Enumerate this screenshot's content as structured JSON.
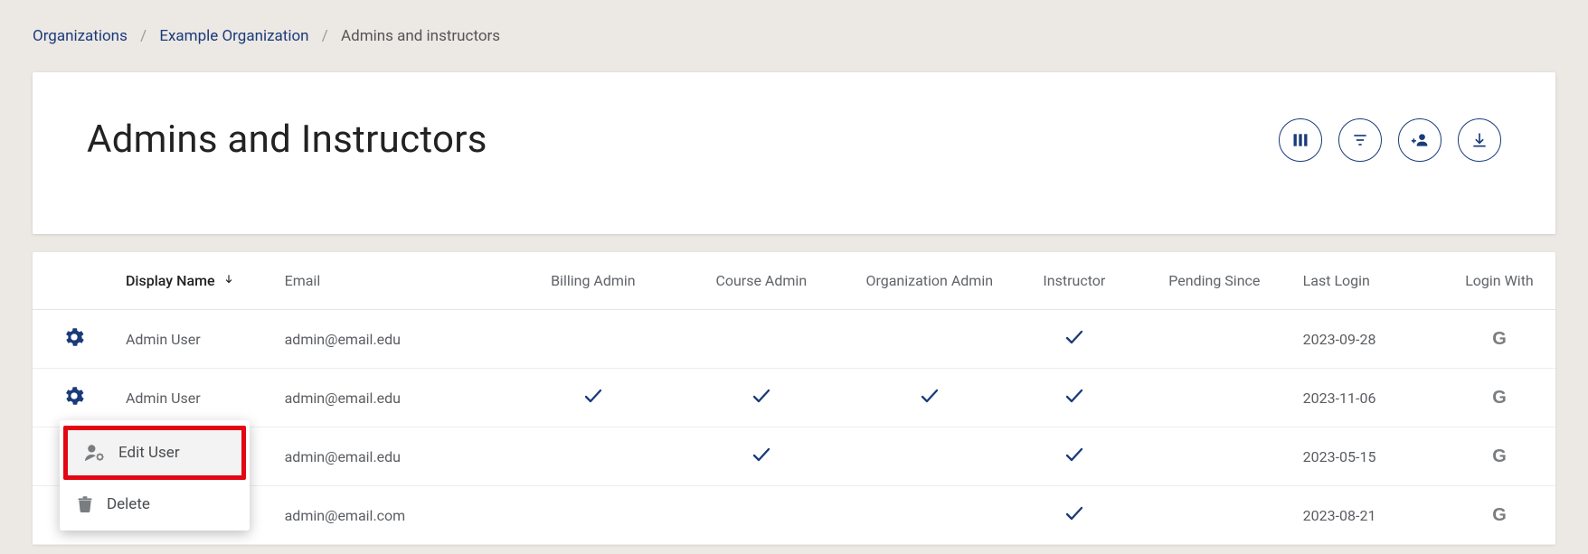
{
  "breadcrumb": {
    "organizations": "Organizations",
    "org": "Example Organization",
    "current": "Admins and instructors"
  },
  "header": {
    "title": "Admins and Instructors"
  },
  "table": {
    "columns": {
      "display_name": "Display Name",
      "email": "Email",
      "billing_admin": "Billing Admin",
      "course_admin": "Course Admin",
      "org_admin": "Organization Admin",
      "instructor": "Instructor",
      "pending_since": "Pending Since",
      "last_login": "Last Login",
      "login_with": "Login With"
    },
    "rows": [
      {
        "display_name": "Admin User",
        "email": "admin@email.edu",
        "billing_admin": false,
        "course_admin": false,
        "org_admin": false,
        "instructor": true,
        "pending_since": "",
        "last_login": "2023-09-28",
        "login_with": "G"
      },
      {
        "display_name": "Admin User",
        "email": "admin@email.edu",
        "billing_admin": true,
        "course_admin": true,
        "org_admin": true,
        "instructor": true,
        "pending_since": "",
        "last_login": "2023-11-06",
        "login_with": "G"
      },
      {
        "display_name": "",
        "email": "admin@email.edu",
        "billing_admin": false,
        "course_admin": true,
        "org_admin": false,
        "instructor": true,
        "pending_since": "",
        "last_login": "2023-05-15",
        "login_with": "G"
      },
      {
        "display_name": "",
        "email": "admin@email.com",
        "billing_admin": false,
        "course_admin": false,
        "org_admin": false,
        "instructor": true,
        "pending_since": "",
        "last_login": "2023-08-21",
        "login_with": "G"
      }
    ]
  },
  "context_menu": {
    "edit_user": "Edit User",
    "delete": "Delete"
  }
}
